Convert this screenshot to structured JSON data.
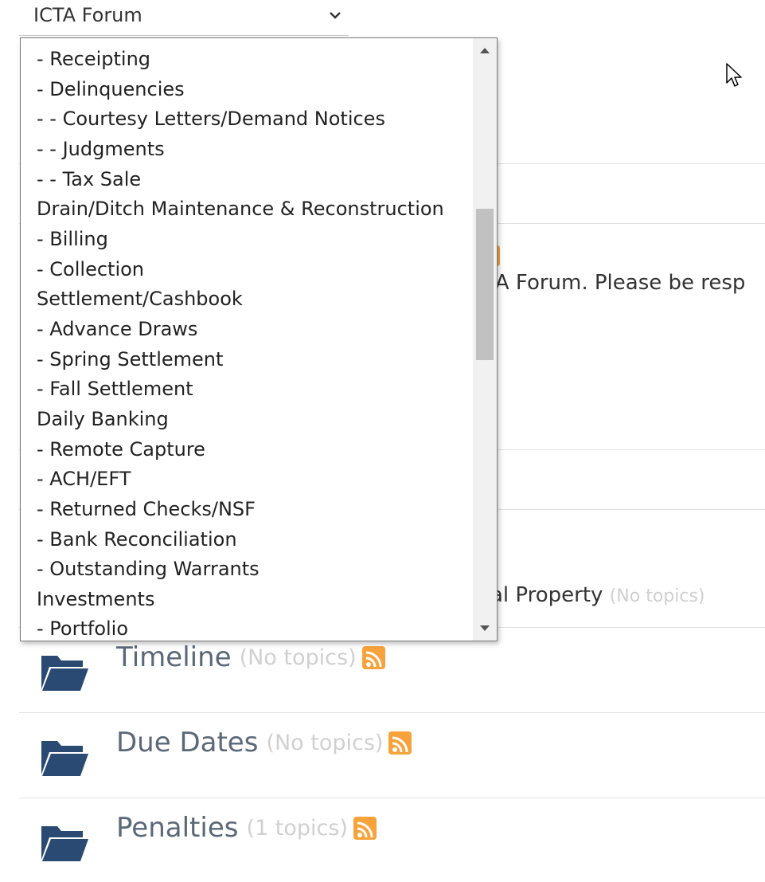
{
  "forum_select": {
    "label": "ICTA Forum",
    "chevron_icon": "chevron-down-icon"
  },
  "dropdown": {
    "options": [
      "- Receipting",
      "- Delinquencies",
      "- - Courtesy Letters/Demand Notices",
      "- - Judgments",
      "- - Tax Sale",
      "Drain/Ditch Maintenance & Reconstruction",
      "- Billing",
      "- Collection",
      "Settlement/Cashbook",
      "- Advance Draws",
      "- Spring Settlement",
      "- Fall Settlement",
      "Daily Banking",
      "- Remote Capture",
      "- ACH/EFT",
      "- Returned Checks/NSF",
      "- Bank Reconciliation",
      "- Outstanding Warrants",
      "Investments",
      "- Portfolio"
    ]
  },
  "background": {
    "notice_peek": "TA Forum. Please be resp",
    "personal_property_peek": "al Property",
    "personal_property_count": "(No topics)"
  },
  "forums": [
    {
      "title": "Timeline",
      "count": "(No topics)"
    },
    {
      "title": "Due Dates",
      "count": "(No topics)"
    },
    {
      "title": "Penalties",
      "count": "(1 topics)"
    }
  ],
  "colors": {
    "rss_orange": "#f7a23a",
    "folder_navy": "#2b4a73",
    "forum_title": "#5b6878"
  }
}
